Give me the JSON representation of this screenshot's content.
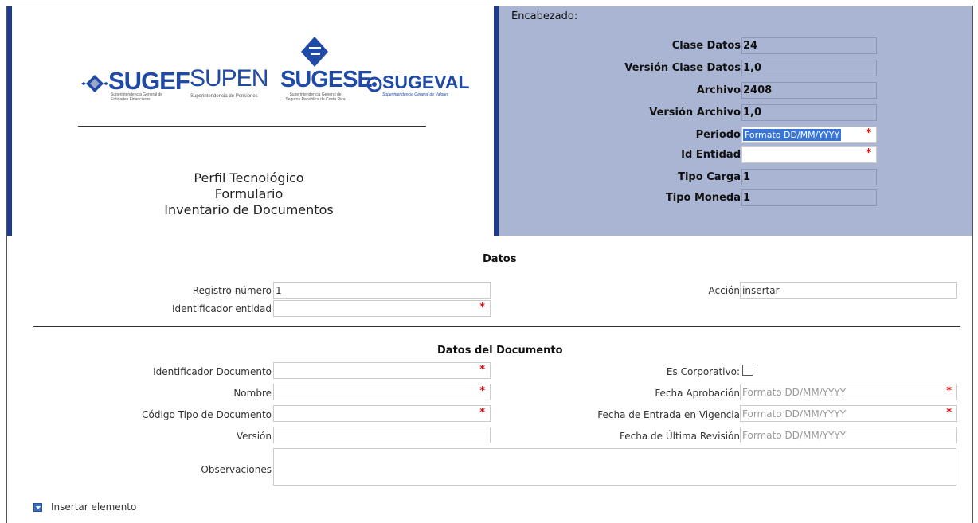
{
  "logos": {
    "sugef": {
      "name": "SUGEF",
      "tagline": "Superintendencia General de Entidades Financieras"
    },
    "supen": {
      "name": "SUPEN",
      "tagline": "Superintendencia de Pensiones"
    },
    "sugese": {
      "name": "SUGESE",
      "tagline": "Superintendencia General de Seguros República de Costa Rica"
    },
    "sugeval": {
      "name": "SUGEVAL",
      "tagline": "Superintendencia General de Valores"
    }
  },
  "title": {
    "line1": "Perfil Tecnológico",
    "line2": "Formulario",
    "line3": "Inventario de Documentos"
  },
  "header": {
    "heading": "Encabezado:",
    "rows": [
      {
        "label": "Clase Datos",
        "value": "24"
      },
      {
        "label": "Versión Clase Datos",
        "value": "1,0"
      },
      {
        "label": "Archivo",
        "value": "2408"
      },
      {
        "label": "Versión Archivo",
        "value": "1,0"
      },
      {
        "label": "Periodo",
        "value": "Formato DD/MM/YYYY"
      },
      {
        "label": "Id Entidad",
        "value": ""
      },
      {
        "label": "Tipo Carga",
        "value": "1"
      },
      {
        "label": "Tipo Moneda",
        "value": "1"
      }
    ],
    "required_marker": "*"
  },
  "datos": {
    "heading": "Datos",
    "registro_label": "Registro número",
    "registro_value": "1",
    "identificador_label": "Identificador entidad",
    "identificador_value": "",
    "accion_label": "Acción",
    "accion_value": "insertar"
  },
  "documento": {
    "heading": "Datos del Documento",
    "id_doc_label": "Identificador Documento",
    "nombre_label": "Nombre",
    "codigo_label": "Código Tipo de Documento",
    "version_label": "Versión",
    "observaciones_label": "Observaciones",
    "corporativo_label": "Es Corporativo:",
    "fecha_aprob_label": "Fecha Aprobación",
    "fecha_aprob_placeholder": "Formato DD/MM/YYYY",
    "fecha_vigencia_label": "Fecha de Entrada en Vigencia",
    "fecha_vigencia_placeholder": "Formato DD/MM/YYYY",
    "fecha_revision_label": "Fecha de Última Revisión",
    "fecha_revision_placeholder": "Formato DD/MM/YYYY"
  },
  "actions": {
    "insert_label": "Insertar elemento"
  },
  "colors": {
    "accent_bar": "#1e3c8f",
    "header_panel": "#a9b5d2",
    "required": "#dd0000",
    "logo_blue": "#1f4aa5"
  }
}
